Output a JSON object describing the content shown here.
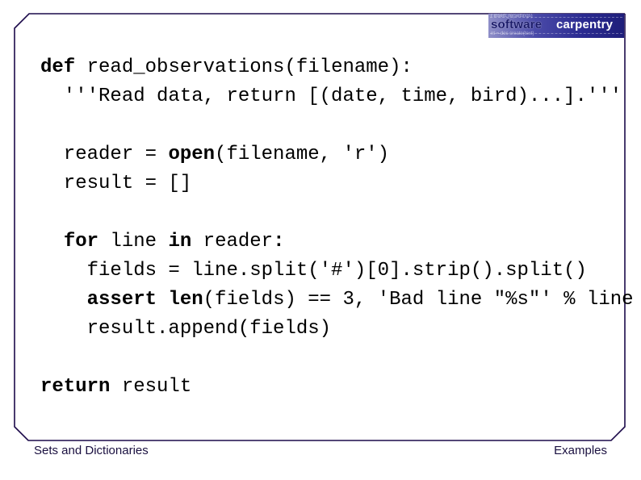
{
  "slide": {
    "code_lines": [
      {
        "id": "def-line",
        "parts": [
          {
            "text": "def",
            "bold": true
          },
          {
            "text": " read_observations(filename):",
            "bold": false
          }
        ]
      },
      {
        "id": "docstring-line",
        "parts": [
          {
            "text": "  '''Read data, return [(date, time, bird)...].'''",
            "bold": false
          }
        ]
      },
      {
        "id": "blank-1",
        "parts": []
      },
      {
        "id": "reader-line",
        "parts": [
          {
            "text": "  reader = ",
            "bold": false
          },
          {
            "text": "open",
            "bold": true
          },
          {
            "text": "(filename, 'r')",
            "bold": false
          }
        ]
      },
      {
        "id": "result-init-line",
        "parts": [
          {
            "text": "  result = []",
            "bold": false
          }
        ]
      },
      {
        "id": "blank-2",
        "parts": []
      },
      {
        "id": "for-line",
        "parts": [
          {
            "text": "  ",
            "bold": false
          },
          {
            "text": "for",
            "bold": true
          },
          {
            "text": " line ",
            "bold": false
          },
          {
            "text": "in",
            "bold": true
          },
          {
            "text": " reader",
            "bold": false
          },
          {
            "text": ":",
            "bold": true
          }
        ]
      },
      {
        "id": "fields-line",
        "parts": [
          {
            "text": "    fields = line.split('#')[0].strip().split()",
            "bold": false
          }
        ]
      },
      {
        "id": "assert-line",
        "parts": [
          {
            "text": "    ",
            "bold": false
          },
          {
            "text": "assert",
            "bold": true
          },
          {
            "text": " ",
            "bold": false
          },
          {
            "text": "len",
            "bold": true
          },
          {
            "text": "(fields) == 3, 'Bad line \"%s\"' % line",
            "bold": false
          }
        ]
      },
      {
        "id": "append-line",
        "parts": [
          {
            "text": "    result.append(fields)",
            "bold": false
          }
        ]
      },
      {
        "id": "blank-3",
        "parts": []
      },
      {
        "id": "return-line",
        "parts": [
          {
            "text": "return",
            "bold": true
          },
          {
            "text": " result",
            "bold": false
          }
        ]
      }
    ]
  },
  "footer": {
    "left": "Sets and Dictionaries",
    "right": "Examples"
  },
  "logo": {
    "word1": "software",
    "word2": "carpentry",
    "bg_text_top": "r insert: re(settings)",
    "bg_text_bottom": "nt = doc create(text)"
  },
  "colors": {
    "frame": "#1c0a4a",
    "footer_text": "#1a1040",
    "code_text": "#000000"
  }
}
